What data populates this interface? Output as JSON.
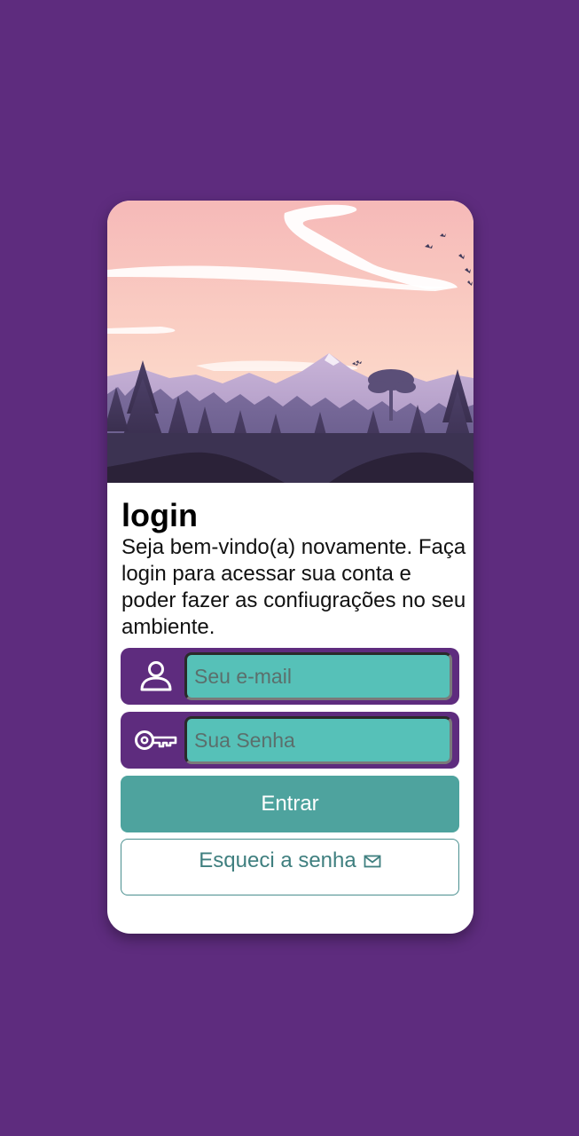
{
  "login_card": {
    "title": "login",
    "subtitle": "Seja bem-vindo(a) novamente. Faça login para acessar sua conta e poder fazer as confiugrações no seu ambiente.",
    "email_field": {
      "icon": "user-icon",
      "placeholder": "Seu e-mail",
      "value": ""
    },
    "password_field": {
      "icon": "key-icon",
      "placeholder": "Sua Senha",
      "value": ""
    },
    "submit_label": "Entrar",
    "forgot_label": "Esqueci a senha",
    "forgot_icon": "mail-icon",
    "hero_image": "mountain-landscape-illustration"
  },
  "colors": {
    "background": "#5e2c7e",
    "card": "#ffffff",
    "field_frame": "#5e2c7e",
    "input_fill": "#56c1b8",
    "primary_button": "#4ea39e",
    "secondary_text": "#3f7f7f"
  }
}
